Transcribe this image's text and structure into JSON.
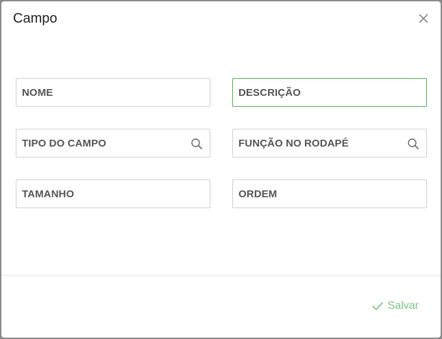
{
  "dialog": {
    "title": "Campo",
    "close_icon": "close-icon"
  },
  "fields": {
    "nome": {
      "label": "NOME"
    },
    "descricao": {
      "label": "DESCRIÇÃO"
    },
    "tipo_do_campo": {
      "label": "TIPO DO CAMPO",
      "icon": "search-icon"
    },
    "funcao_no_rodape": {
      "label": "FUNÇÃO NO RODAPÉ",
      "icon": "search-icon"
    },
    "tamanho": {
      "label": "TAMANHO"
    },
    "ordem": {
      "label": "ORDEM"
    }
  },
  "footer": {
    "save_label": "Salvar",
    "save_icon": "check-icon"
  },
  "colors": {
    "focus_border": "#4caf50",
    "save_text": "#7dc784",
    "label_text": "#555555",
    "field_border": "#cfcfcf"
  }
}
